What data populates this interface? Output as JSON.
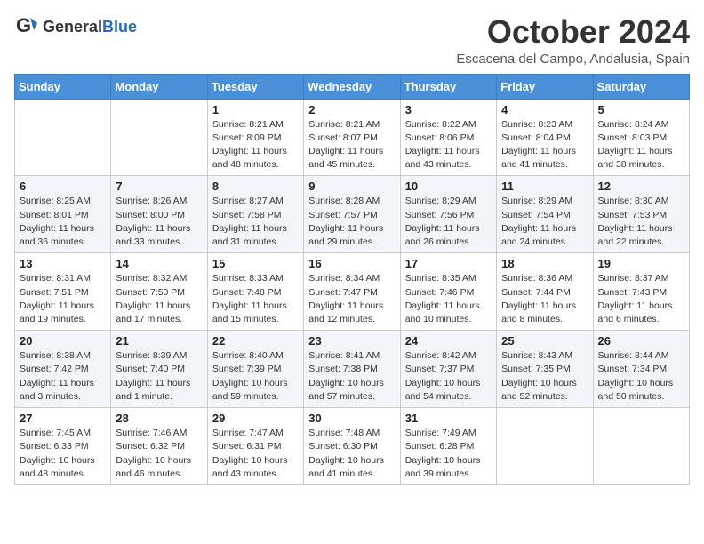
{
  "logo": {
    "text_general": "General",
    "text_blue": "Blue"
  },
  "header": {
    "month": "October 2024",
    "location": "Escacena del Campo, Andalusia, Spain"
  },
  "weekdays": [
    "Sunday",
    "Monday",
    "Tuesday",
    "Wednesday",
    "Thursday",
    "Friday",
    "Saturday"
  ],
  "weeks": [
    [
      {
        "day": "",
        "info": ""
      },
      {
        "day": "",
        "info": ""
      },
      {
        "day": "1",
        "info": "Sunrise: 8:21 AM\nSunset: 8:09 PM\nDaylight: 11 hours and 48 minutes."
      },
      {
        "day": "2",
        "info": "Sunrise: 8:21 AM\nSunset: 8:07 PM\nDaylight: 11 hours and 45 minutes."
      },
      {
        "day": "3",
        "info": "Sunrise: 8:22 AM\nSunset: 8:06 PM\nDaylight: 11 hours and 43 minutes."
      },
      {
        "day": "4",
        "info": "Sunrise: 8:23 AM\nSunset: 8:04 PM\nDaylight: 11 hours and 41 minutes."
      },
      {
        "day": "5",
        "info": "Sunrise: 8:24 AM\nSunset: 8:03 PM\nDaylight: 11 hours and 38 minutes."
      }
    ],
    [
      {
        "day": "6",
        "info": "Sunrise: 8:25 AM\nSunset: 8:01 PM\nDaylight: 11 hours and 36 minutes."
      },
      {
        "day": "7",
        "info": "Sunrise: 8:26 AM\nSunset: 8:00 PM\nDaylight: 11 hours and 33 minutes."
      },
      {
        "day": "8",
        "info": "Sunrise: 8:27 AM\nSunset: 7:58 PM\nDaylight: 11 hours and 31 minutes."
      },
      {
        "day": "9",
        "info": "Sunrise: 8:28 AM\nSunset: 7:57 PM\nDaylight: 11 hours and 29 minutes."
      },
      {
        "day": "10",
        "info": "Sunrise: 8:29 AM\nSunset: 7:56 PM\nDaylight: 11 hours and 26 minutes."
      },
      {
        "day": "11",
        "info": "Sunrise: 8:29 AM\nSunset: 7:54 PM\nDaylight: 11 hours and 24 minutes."
      },
      {
        "day": "12",
        "info": "Sunrise: 8:30 AM\nSunset: 7:53 PM\nDaylight: 11 hours and 22 minutes."
      }
    ],
    [
      {
        "day": "13",
        "info": "Sunrise: 8:31 AM\nSunset: 7:51 PM\nDaylight: 11 hours and 19 minutes."
      },
      {
        "day": "14",
        "info": "Sunrise: 8:32 AM\nSunset: 7:50 PM\nDaylight: 11 hours and 17 minutes."
      },
      {
        "day": "15",
        "info": "Sunrise: 8:33 AM\nSunset: 7:48 PM\nDaylight: 11 hours and 15 minutes."
      },
      {
        "day": "16",
        "info": "Sunrise: 8:34 AM\nSunset: 7:47 PM\nDaylight: 11 hours and 12 minutes."
      },
      {
        "day": "17",
        "info": "Sunrise: 8:35 AM\nSunset: 7:46 PM\nDaylight: 11 hours and 10 minutes."
      },
      {
        "day": "18",
        "info": "Sunrise: 8:36 AM\nSunset: 7:44 PM\nDaylight: 11 hours and 8 minutes."
      },
      {
        "day": "19",
        "info": "Sunrise: 8:37 AM\nSunset: 7:43 PM\nDaylight: 11 hours and 6 minutes."
      }
    ],
    [
      {
        "day": "20",
        "info": "Sunrise: 8:38 AM\nSunset: 7:42 PM\nDaylight: 11 hours and 3 minutes."
      },
      {
        "day": "21",
        "info": "Sunrise: 8:39 AM\nSunset: 7:40 PM\nDaylight: 11 hours and 1 minute."
      },
      {
        "day": "22",
        "info": "Sunrise: 8:40 AM\nSunset: 7:39 PM\nDaylight: 10 hours and 59 minutes."
      },
      {
        "day": "23",
        "info": "Sunrise: 8:41 AM\nSunset: 7:38 PM\nDaylight: 10 hours and 57 minutes."
      },
      {
        "day": "24",
        "info": "Sunrise: 8:42 AM\nSunset: 7:37 PM\nDaylight: 10 hours and 54 minutes."
      },
      {
        "day": "25",
        "info": "Sunrise: 8:43 AM\nSunset: 7:35 PM\nDaylight: 10 hours and 52 minutes."
      },
      {
        "day": "26",
        "info": "Sunrise: 8:44 AM\nSunset: 7:34 PM\nDaylight: 10 hours and 50 minutes."
      }
    ],
    [
      {
        "day": "27",
        "info": "Sunrise: 7:45 AM\nSunset: 6:33 PM\nDaylight: 10 hours and 48 minutes."
      },
      {
        "day": "28",
        "info": "Sunrise: 7:46 AM\nSunset: 6:32 PM\nDaylight: 10 hours and 46 minutes."
      },
      {
        "day": "29",
        "info": "Sunrise: 7:47 AM\nSunset: 6:31 PM\nDaylight: 10 hours and 43 minutes."
      },
      {
        "day": "30",
        "info": "Sunrise: 7:48 AM\nSunset: 6:30 PM\nDaylight: 10 hours and 41 minutes."
      },
      {
        "day": "31",
        "info": "Sunrise: 7:49 AM\nSunset: 6:28 PM\nDaylight: 10 hours and 39 minutes."
      },
      {
        "day": "",
        "info": ""
      },
      {
        "day": "",
        "info": ""
      }
    ]
  ]
}
